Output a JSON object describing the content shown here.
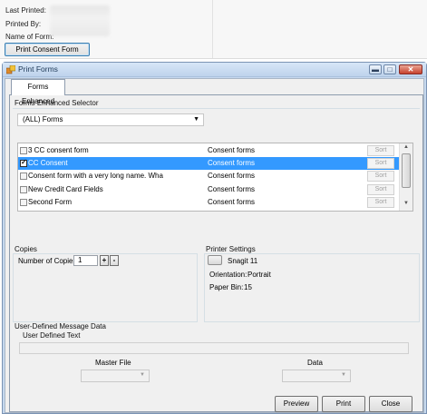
{
  "info": {
    "last_printed_label": "Last Printed:",
    "printed_by_label": "Printed By:",
    "name_of_form_label": "Name of Form:",
    "print_consent_button": "Print Consent Form"
  },
  "window": {
    "title": "Print Forms",
    "min_glyph": "▬",
    "max_glyph": "□",
    "close_glyph": "✕"
  },
  "tab": {
    "label": "Forms Enhanced"
  },
  "selector": {
    "label": "Forms Enhanced Selector",
    "value": "(ALL) Forms",
    "arrow": "▼"
  },
  "forms_list": {
    "sort_label": "Sort",
    "rows": [
      {
        "name": "3 CC consent form",
        "category": "Consent forms",
        "checked": false,
        "selected": false
      },
      {
        "name": "CC Consent",
        "category": "Consent forms",
        "checked": true,
        "selected": true
      },
      {
        "name": "Consent form with a very long name.  Wha",
        "category": "Consent forms",
        "checked": false,
        "selected": false
      },
      {
        "name": "New Credit Card Fields",
        "category": "Consent forms",
        "checked": false,
        "selected": false
      },
      {
        "name": "Second Form",
        "category": "Consent forms",
        "checked": false,
        "selected": false
      }
    ],
    "scroll_up": "▲",
    "scroll_down": "▼"
  },
  "copies": {
    "group_label": "Copies",
    "label": "Number of Copies:",
    "value": "1",
    "up": "+",
    "down": "-"
  },
  "printer": {
    "group_label": "Printer Settings",
    "name": "Snagit 11",
    "orientation_label": "Orientation:",
    "orientation_value": "Portrait",
    "paper_bin_label": "Paper Bin:",
    "paper_bin_value": "15"
  },
  "user_defined": {
    "group_label": "User-Defined Message Data",
    "text_label": "User Defined Text",
    "master_file_label": "Master File",
    "data_label": "Data",
    "arrow": "▼"
  },
  "actions": {
    "preview": "Preview",
    "print": "Print",
    "close": "Close"
  },
  "colors": {
    "selection": "#3399ff",
    "title_bar": "#c5d8ee",
    "close_button": "#c7422e"
  }
}
